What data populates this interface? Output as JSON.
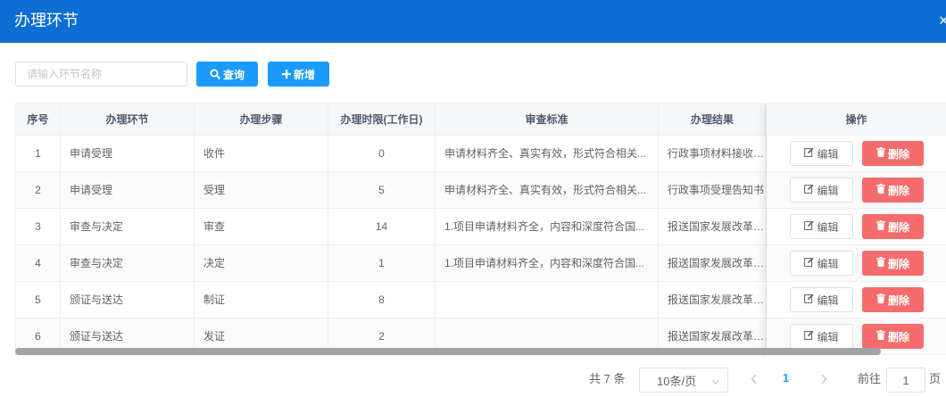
{
  "dialog": {
    "title": "办理环节",
    "close_symbol": "×"
  },
  "toolbar": {
    "search_placeholder": "请输入环节名称",
    "search_value": "",
    "query_label": "查询",
    "add_label": "新增"
  },
  "table": {
    "columns": [
      "序号",
      "办理环节",
      "办理步骤",
      "办理时限(工作日)",
      "审查标准",
      "办理结果",
      "操作"
    ],
    "rows": [
      {
        "no": "1",
        "stage": "申请受理",
        "step": "收件",
        "limit": "0",
        "standard": "申请材料齐全、真实有效，形式符合相关...",
        "result": "行政事项材料接收通..."
      },
      {
        "no": "2",
        "stage": "申请受理",
        "step": "受理",
        "limit": "5",
        "standard": "申请材料齐全、真实有效，形式符合相关...",
        "result": "行政事项受理告知书"
      },
      {
        "no": "3",
        "stage": "审查与决定",
        "step": "审查",
        "limit": "14",
        "standard": "1.项目申请材料齐全，内容和深度符合国...",
        "result": "报送国家发展改革委..."
      },
      {
        "no": "4",
        "stage": "审查与决定",
        "step": "决定",
        "limit": "1",
        "standard": "1.项目申请材料齐全，内容和深度符合国...",
        "result": "报送国家发展改革委..."
      },
      {
        "no": "5",
        "stage": "颁证与送达",
        "step": "制证",
        "limit": "8",
        "standard": "",
        "result": "报送国家发展改革委..."
      },
      {
        "no": "6",
        "stage": "颁证与送达",
        "step": "发证",
        "limit": "2",
        "standard": "",
        "result": "报送国家发展改革委..."
      }
    ],
    "edit_label": "编辑",
    "delete_label": "删除"
  },
  "pagination": {
    "total_text": "共 7 条",
    "page_size": "10条/页",
    "current_page": "1",
    "goto_label": "前往",
    "goto_value": "1",
    "page_unit": "页"
  },
  "colors": {
    "header": "#0d6fd4",
    "primary": "#1a9bfc",
    "danger": "#f66c6c"
  }
}
